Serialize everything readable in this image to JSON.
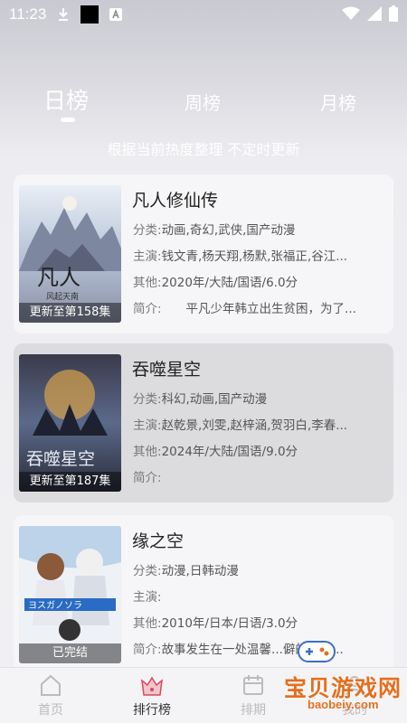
{
  "status": {
    "time": "11:23"
  },
  "tabs": {
    "day": "日榜",
    "week": "周榜",
    "month": "月榜"
  },
  "subtitle": "根据当前热度整理 不定时更新",
  "labels": {
    "genre": "分类:",
    "cast": "主演:",
    "other": "其他:",
    "intro": "简介:"
  },
  "items": [
    {
      "title": "凡人修仙传",
      "genre": "动画,奇幻,武侠,国产动漫",
      "cast": "钱文青,杨天翔,杨默,张福正,谷江...",
      "other": "2020年/大陆/国语/6.0分",
      "intro": "　　平凡少年韩立出生贫困，为了...",
      "badge": "更新至第158集",
      "poster_text": "凡人"
    },
    {
      "title": "吞噬星空",
      "genre": "科幻,动画,国产动漫",
      "cast": "赵乾景,刘雯,赵梓涵,贺羽白,李春...",
      "other": "2024年/大陆/国语/9.0分",
      "intro": "",
      "badge": "更新至第187集",
      "poster_text": "吞噬星空"
    },
    {
      "title": "缘之空",
      "genre": "动漫,日韩动漫",
      "cast": "",
      "other": "2010年/日本/日语/3.0分",
      "intro": "故事发生在一处温馨...僻的田园...",
      "badge": "已完结",
      "poster_text": "ヨスガノソラ"
    }
  ],
  "nav": {
    "home": "首页",
    "rank": "排行榜",
    "schedule": "排期",
    "mine": "我的"
  },
  "watermark": {
    "text": "宝贝游戏网",
    "url": "baobeiy.com"
  }
}
